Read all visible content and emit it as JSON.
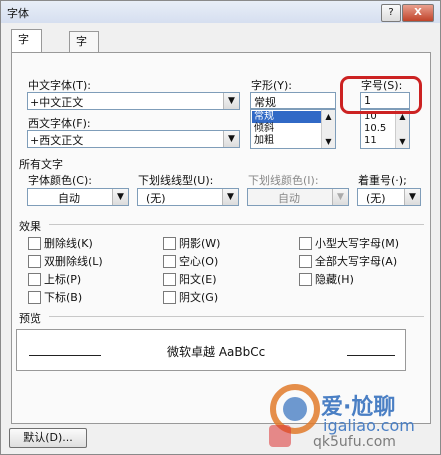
{
  "window": {
    "title": "字体",
    "help_label": "?",
    "close_label": "X"
  },
  "tabs": [
    {
      "label": "字体(N)"
    },
    {
      "label": "字符间距(R)"
    }
  ],
  "font": {
    "cn_label": "中文字体(T):",
    "cn_value": "+中文正文",
    "west_label": "西文字体(F):",
    "west_value": "+西文正文",
    "style_label": "字形(Y):",
    "style_input": "常规",
    "style_options": [
      "常规",
      "倾斜",
      "加粗"
    ],
    "style_selected": 0,
    "size_label": "字号(S):",
    "size_input": "1",
    "size_options": [
      "10",
      "10.5",
      "11"
    ]
  },
  "all_text": {
    "section_label": "所有文字",
    "color_label": "字体颜色(C):",
    "color_value": "自动",
    "underline_label": "下划线线型(U):",
    "underline_value": "(无)",
    "underline_color_label": "下划线颜色(I):",
    "underline_color_value": "自动",
    "emphasis_label": "着重号(·);",
    "emphasis_value": "(无)"
  },
  "effects": {
    "section_label": "效果",
    "col1": [
      "删除线(K)",
      "双删除线(L)",
      "上标(P)",
      "下标(B)"
    ],
    "col2": [
      "阴影(W)",
      "空心(O)",
      "阳文(E)",
      "阴文(G)"
    ],
    "col3": [
      "小型大写字母(M)",
      "全部大写字母(A)",
      "隐藏(H)"
    ]
  },
  "preview": {
    "section_label": "预览",
    "sample_text": "微软卓越 AaBbCc"
  },
  "footer": {
    "default_button": "默认(D)..."
  },
  "watermark": {
    "logo_text": "爱·尬聊",
    "line1": "igaliao.com",
    "line2": "qk5ufu.com"
  },
  "colors": {
    "highlight": "#3169c6",
    "annotation_red": "#cc2222",
    "watermark_blue": "#4a7fc4",
    "watermark_orange": "#e07a2a"
  }
}
